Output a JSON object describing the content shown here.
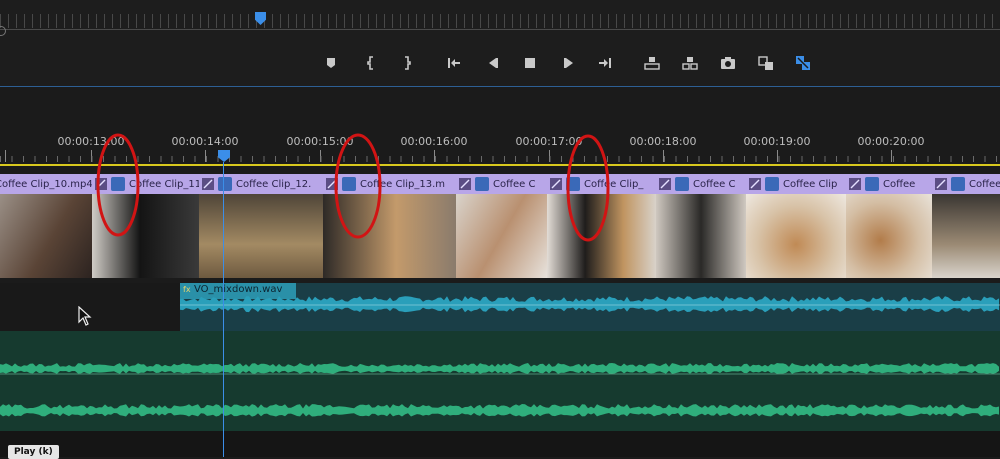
{
  "ruler": {
    "timecodes": [
      "00:00:13:00",
      "00:00:14:00",
      "00:00:15:00",
      "00:00:16:00",
      "00:00:17:00",
      "00:00:18:00",
      "00:00:19:00",
      "00:00:20:00"
    ]
  },
  "transport": {
    "buttons": [
      {
        "name": "add-marker-icon"
      },
      {
        "name": "mark-in-icon"
      },
      {
        "name": "mark-out-icon"
      },
      {
        "name": "go-to-in-icon"
      },
      {
        "name": "step-back-icon"
      },
      {
        "name": "stop-icon"
      },
      {
        "name": "step-forward-icon"
      },
      {
        "name": "go-to-out-icon"
      },
      {
        "name": "lift-icon"
      },
      {
        "name": "extract-icon"
      },
      {
        "name": "export-frame-icon"
      },
      {
        "name": "compare-view-icon"
      },
      {
        "name": "settings-toggle-icon"
      }
    ]
  },
  "video": {
    "clips": [
      {
        "label": "Coffee Clip_10.mp4",
        "bg": "#6a5444"
      },
      {
        "label": "Coffee Clip_11.",
        "bg": "#9e9b97"
      },
      {
        "label": "Coffee Clip_12.",
        "bg": "#8c7a60"
      },
      {
        "label": "Coffee Clip_13.m",
        "bg": "#6c6257"
      },
      {
        "label": "Coffee C",
        "bg": "#b6a79a"
      },
      {
        "label": "Coffee Clip_",
        "bg": "#b8a896"
      },
      {
        "label": "Coffee C",
        "bg": "#938677"
      },
      {
        "label": "Coffee Clip",
        "bg": "#c4a98c"
      },
      {
        "label": "Coffee",
        "bg": "#b89a7c"
      },
      {
        "label": "Coffee",
        "bg": "#a48c70"
      }
    ]
  },
  "audio": {
    "vo_clip_label": "VO_mixdown.wav"
  },
  "tooltip": {
    "play": "Play (k)"
  },
  "colors": {
    "accent": "#3b8ee8",
    "clip_header": "#b8a6e8",
    "vo_waveform": "#2a9fba",
    "music_waveform": "#2fae7c",
    "annotation": "#d11414",
    "work_area": "#d8c81e"
  }
}
